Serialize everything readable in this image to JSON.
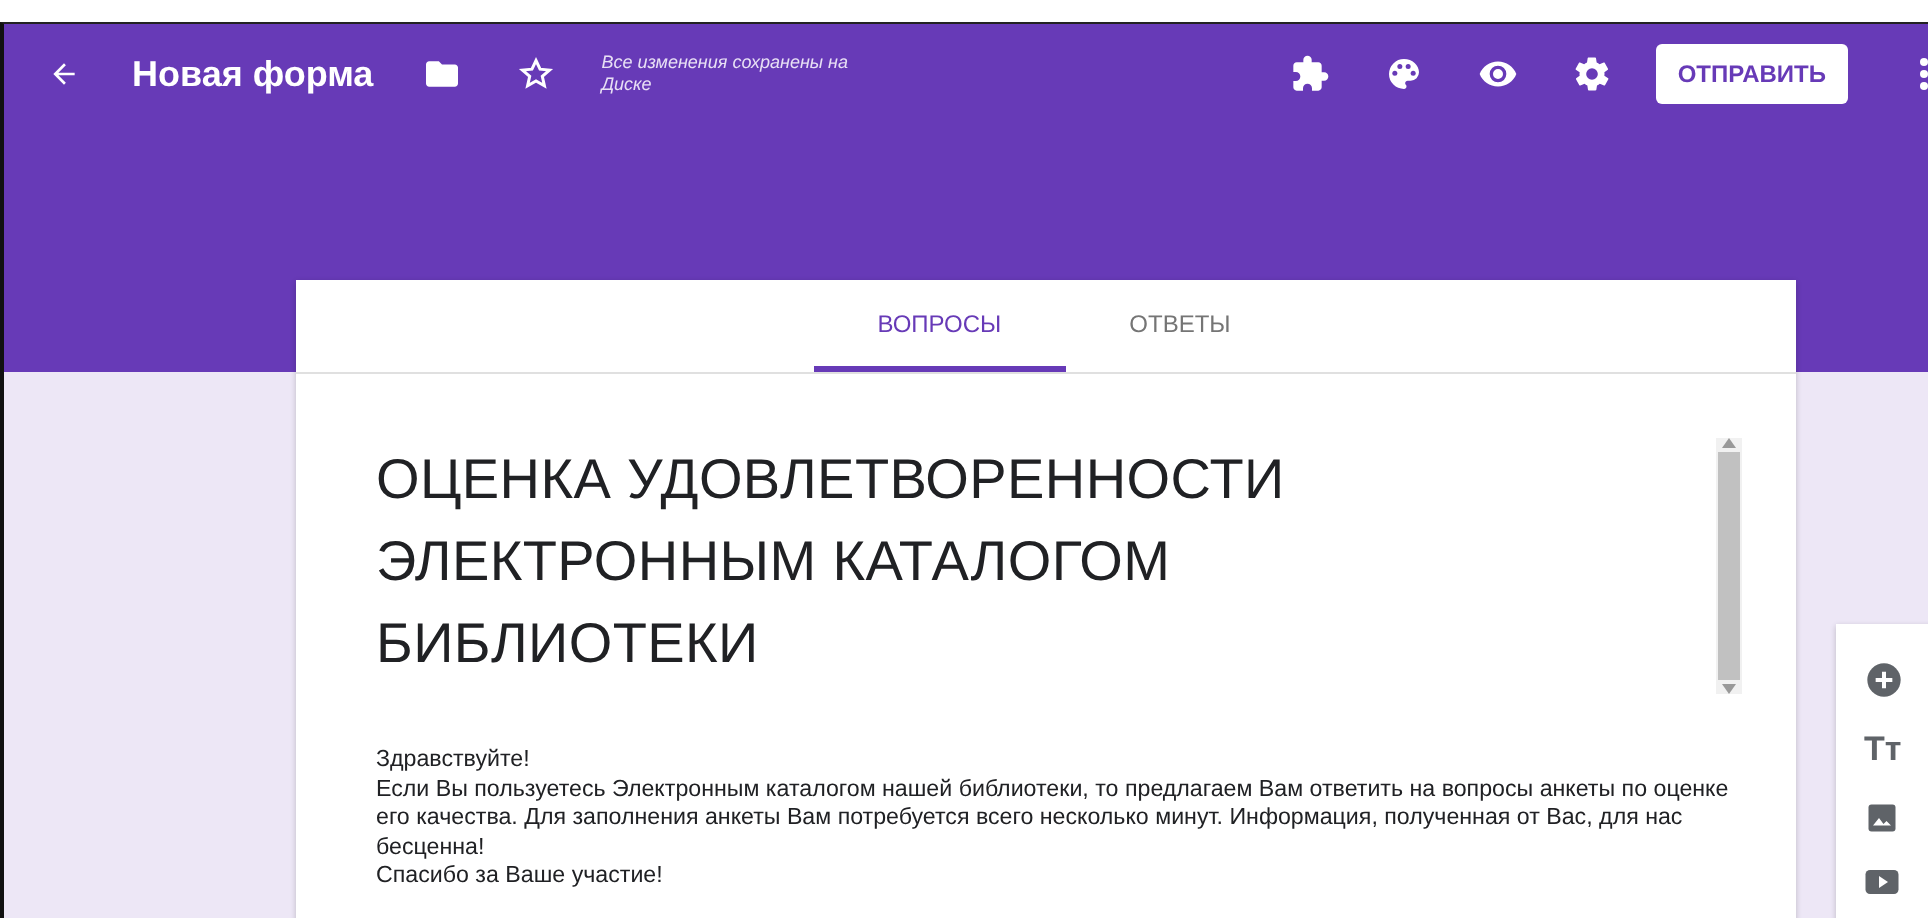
{
  "header": {
    "title": "Новая форма",
    "save_status": "Все изменения сохранены на Диске",
    "send_button": "ОТПРАВИТЬ"
  },
  "tabs": [
    {
      "label": "ВОПРОСЫ",
      "selected": true
    },
    {
      "label": "ОТВЕТЫ",
      "selected": false
    }
  ],
  "form": {
    "title": "ОЦЕНКА УДОВЛЕТВОРЕННОСТИ ЭЛЕКТРОННЫМ КАТАЛОГОМ БИБЛИОТЕКИ",
    "description": [
      "Здравствуйте!",
      "Если Вы пользуетесь Электронным каталогом нашей библиотеки, то предлагаем Вам ответить на вопросы анкеты по оценке его качества. Для заполнения анкеты Вам потребуется всего несколько минут. Информация, полученная от Вас, для нас бесценна!",
      "Спасибо за Ваше участие!"
    ]
  },
  "side_toolbar": {
    "text_icon": "Тт"
  }
}
